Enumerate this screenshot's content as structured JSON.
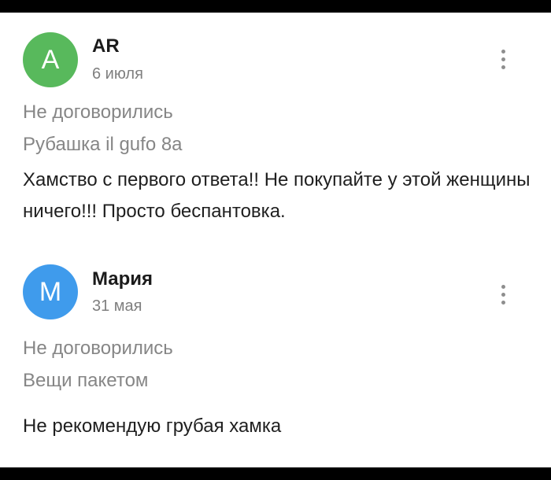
{
  "reviews": [
    {
      "avatar_letter": "A",
      "avatar_color": "#58b95c",
      "author": "AR",
      "date": "6 июля",
      "status": "Не договорились",
      "item": "Рубашка il gufo 8а",
      "text": "Хамство с первого ответа!! Не покупайте у этой женщины ничего!!! Просто беспантовка.",
      "menu_icon": "more-vertical-icon"
    },
    {
      "avatar_letter": "М",
      "avatar_color": "#3f9bec",
      "author": "Мария",
      "date": "31 мая",
      "status": "Не договорились",
      "item": "Вещи пакетом",
      "text": "Не рекомендую грубая хамка",
      "menu_icon": "more-vertical-icon"
    }
  ]
}
